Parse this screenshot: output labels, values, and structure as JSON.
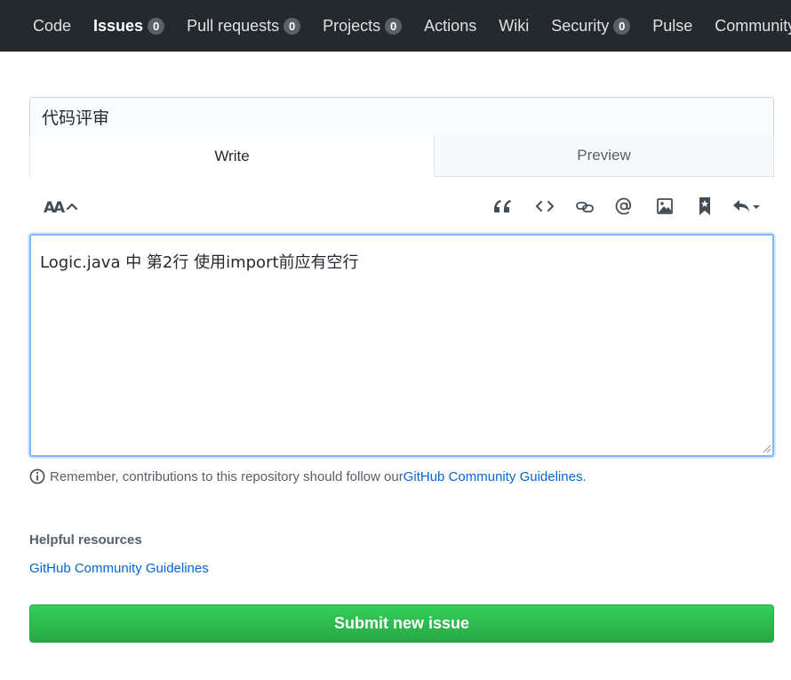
{
  "nav": {
    "items": [
      {
        "label": "Code",
        "count": null,
        "active": false
      },
      {
        "label": "Issues",
        "count": "0",
        "active": true
      },
      {
        "label": "Pull requests",
        "count": "0",
        "active": false
      },
      {
        "label": "Projects",
        "count": "0",
        "active": false
      },
      {
        "label": "Actions",
        "count": null,
        "active": false
      },
      {
        "label": "Wiki",
        "count": null,
        "active": false
      },
      {
        "label": "Security",
        "count": "0",
        "active": false
      },
      {
        "label": "Pulse",
        "count": null,
        "active": false
      },
      {
        "label": "Community",
        "count": null,
        "active": false
      }
    ]
  },
  "issue": {
    "title_value": "代码评审",
    "body_value": "Logic.java 中 第2行 使用import前应有空行"
  },
  "tabs": {
    "write": "Write",
    "preview": "Preview"
  },
  "toolbar": {
    "icons": [
      "text-size-icon",
      "quote-icon",
      "code-icon",
      "link-icon",
      "mention-icon",
      "image-icon",
      "bookmark-icon",
      "reply-icon"
    ]
  },
  "reminder": {
    "text": "Remember, contributions to this repository should follow our ",
    "link": "GitHub Community Guidelines",
    "suffix": "."
  },
  "helpful": {
    "title": "Helpful resources",
    "link": "GitHub Community Guidelines"
  },
  "submit_label": "Submit new issue",
  "colors": {
    "nav_bg": "#24292e",
    "link": "#0366d6",
    "submit": "#2cbe4e"
  }
}
